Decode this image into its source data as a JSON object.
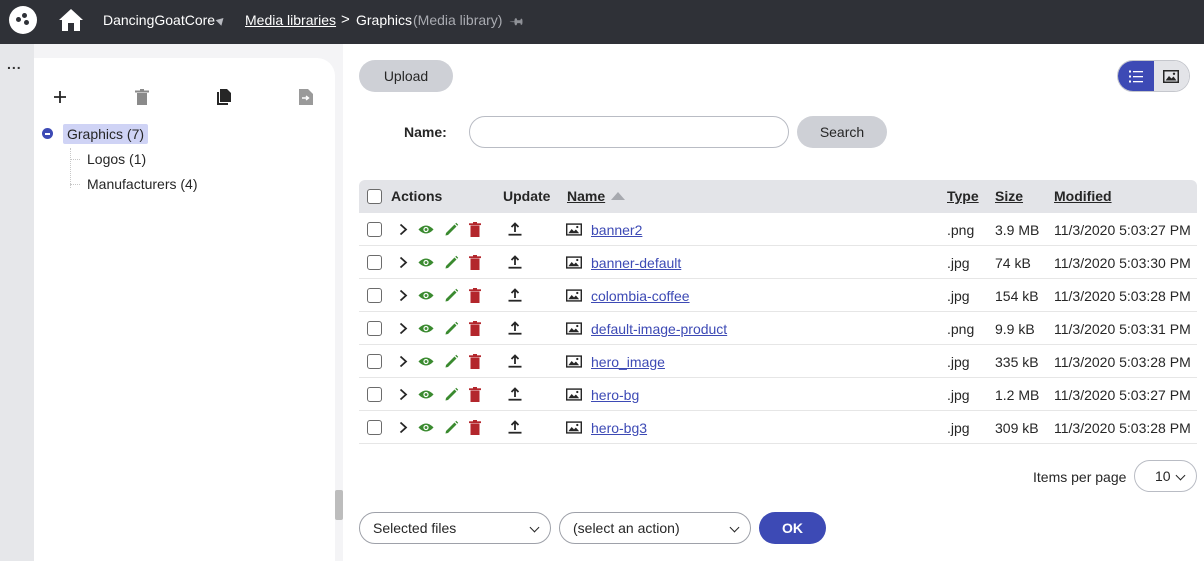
{
  "topbar": {
    "site": "DancingGoatCore",
    "breadcrumb_link": "Media libraries",
    "breadcrumb_separator": ">",
    "breadcrumb_current": "Graphics",
    "breadcrumb_sub": "(Media library)"
  },
  "rail": {
    "menu_label": "..."
  },
  "tree": {
    "tools": [
      "plus-icon",
      "trash-icon",
      "copy-icon",
      "move-icon"
    ],
    "root": "Graphics (7)",
    "children": [
      "Logos (1)",
      "Manufacturers (4)"
    ]
  },
  "toolbar": {
    "upload_label": "Upload",
    "name_label": "Name:",
    "search_value": "",
    "search_label": "Search"
  },
  "grid": {
    "headers": {
      "actions": "Actions",
      "update": "Update",
      "name": "Name",
      "type": "Type",
      "size": "Size",
      "modified": "Modified"
    },
    "rows": [
      {
        "name": "banner2",
        "type": ".png",
        "size": "3.9 MB",
        "modified": "11/3/2020 5:03:27 PM"
      },
      {
        "name": "banner-default",
        "type": ".jpg",
        "size": "74 kB",
        "modified": "11/3/2020 5:03:30 PM"
      },
      {
        "name": "colombia-coffee",
        "type": ".jpg",
        "size": "154 kB",
        "modified": "11/3/2020 5:03:28 PM"
      },
      {
        "name": "default-image-product",
        "type": ".png",
        "size": "9.9 kB",
        "modified": "11/3/2020 5:03:31 PM"
      },
      {
        "name": "hero_image",
        "type": ".jpg",
        "size": "335 kB",
        "modified": "11/3/2020 5:03:28 PM"
      },
      {
        "name": "hero-bg",
        "type": ".jpg",
        "size": "1.2 MB",
        "modified": "11/3/2020 5:03:27 PM"
      },
      {
        "name": "hero-bg3",
        "type": ".jpg",
        "size": "309 kB",
        "modified": "11/3/2020 5:03:28 PM"
      }
    ]
  },
  "pager": {
    "items_per_page_label": "Items per page",
    "items_per_page_value": "10"
  },
  "footer": {
    "scope_select": "Selected files",
    "action_select": "(select an action)",
    "ok_label": "OK"
  },
  "colors": {
    "topbar": "#2f3137",
    "accent": "#3d4ab5",
    "view_green": "#3a8a2f",
    "delete_red": "#b3262c"
  }
}
